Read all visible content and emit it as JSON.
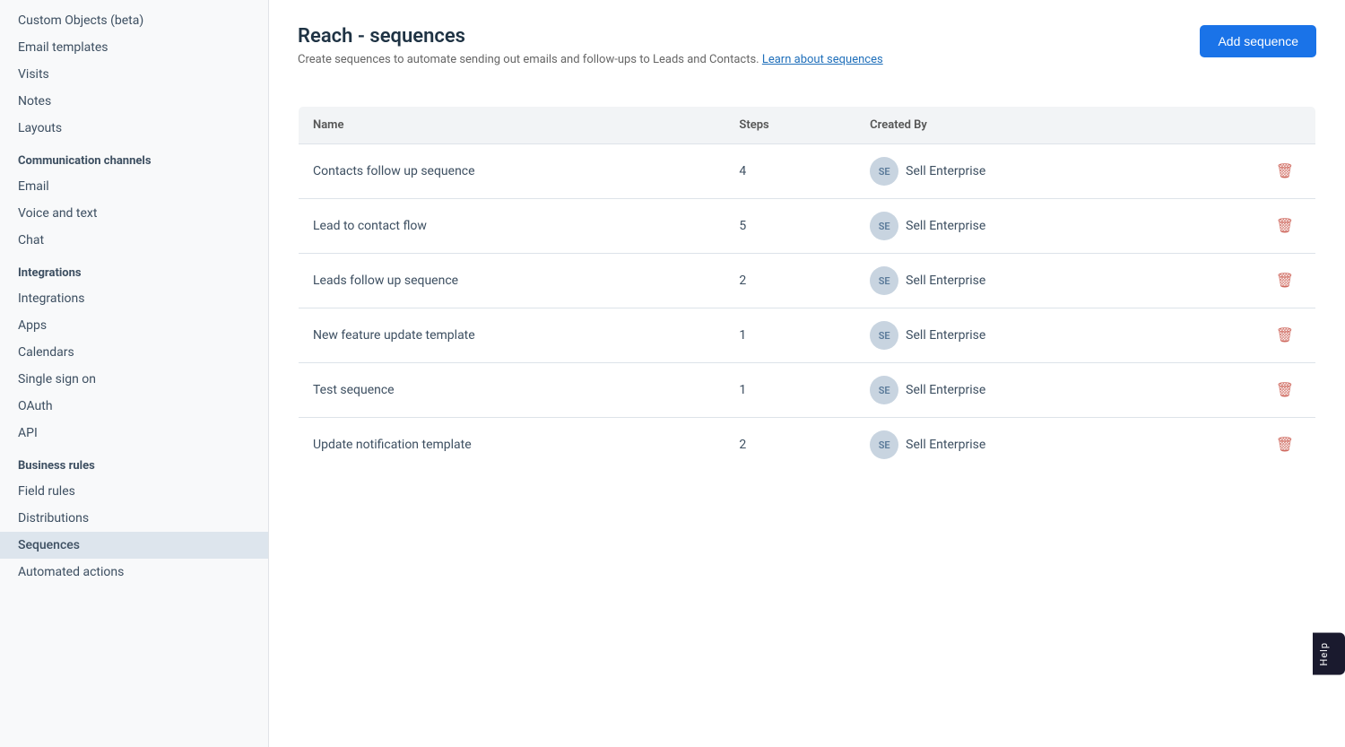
{
  "sidebar": {
    "items_top": [
      {
        "label": "Custom Objects (beta)",
        "id": "custom-objects",
        "active": false
      },
      {
        "label": "Email templates",
        "id": "email-templates",
        "active": false
      },
      {
        "label": "Visits",
        "id": "visits",
        "active": false
      },
      {
        "label": "Notes",
        "id": "notes",
        "active": false
      },
      {
        "label": "Layouts",
        "id": "layouts",
        "active": false
      }
    ],
    "sections": [
      {
        "header": "Communication channels",
        "items": [
          {
            "label": "Email",
            "id": "email",
            "active": false
          },
          {
            "label": "Voice and text",
            "id": "voice-and-text",
            "active": false
          },
          {
            "label": "Chat",
            "id": "chat",
            "active": false
          }
        ]
      },
      {
        "header": "Integrations",
        "items": [
          {
            "label": "Integrations",
            "id": "integrations",
            "active": false
          },
          {
            "label": "Apps",
            "id": "apps",
            "active": false
          },
          {
            "label": "Calendars",
            "id": "calendars",
            "active": false
          },
          {
            "label": "Single sign on",
            "id": "sso",
            "active": false
          },
          {
            "label": "OAuth",
            "id": "oauth",
            "active": false
          },
          {
            "label": "API",
            "id": "api",
            "active": false
          }
        ]
      },
      {
        "header": "Business rules",
        "items": [
          {
            "label": "Field rules",
            "id": "field-rules",
            "active": false
          },
          {
            "label": "Distributions",
            "id": "distributions",
            "active": false
          },
          {
            "label": "Sequences",
            "id": "sequences",
            "active": true
          },
          {
            "label": "Automated actions",
            "id": "automated-actions",
            "active": false
          }
        ]
      }
    ]
  },
  "page": {
    "title": "Reach - sequences",
    "subtitle_text": "Create sequences to automate sending out emails and follow-ups to Leads and Contacts.",
    "subtitle_link": "Learn about sequences",
    "add_button": "Add sequence"
  },
  "table": {
    "columns": [
      {
        "label": "Name",
        "id": "name"
      },
      {
        "label": "Steps",
        "id": "steps"
      },
      {
        "label": "Created By",
        "id": "created-by"
      },
      {
        "label": "",
        "id": "actions"
      }
    ],
    "rows": [
      {
        "name": "Contacts follow up sequence",
        "steps": "4",
        "creator_initials": "SE",
        "creator_name": "Sell Enterprise"
      },
      {
        "name": "Lead to contact flow",
        "steps": "5",
        "creator_initials": "SE",
        "creator_name": "Sell Enterprise"
      },
      {
        "name": "Leads follow up sequence",
        "steps": "2",
        "creator_initials": "SE",
        "creator_name": "Sell Enterprise"
      },
      {
        "name": "New feature update template",
        "steps": "1",
        "creator_initials": "SE",
        "creator_name": "Sell Enterprise"
      },
      {
        "name": "Test sequence",
        "steps": "1",
        "creator_initials": "SE",
        "creator_name": "Sell Enterprise"
      },
      {
        "name": "Update notification template",
        "steps": "2",
        "creator_initials": "SE",
        "creator_name": "Sell Enterprise"
      }
    ]
  },
  "help_widget": "Help"
}
